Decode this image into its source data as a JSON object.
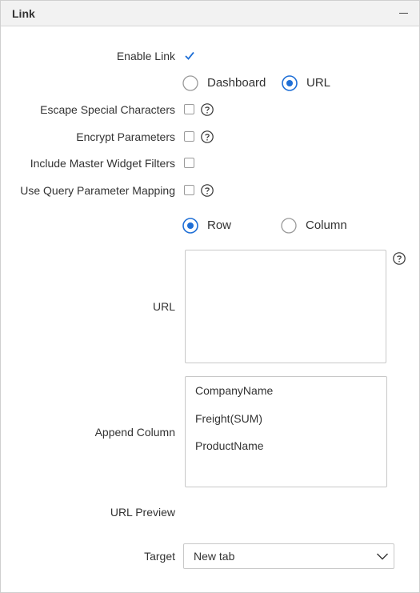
{
  "panel": {
    "title": "Link",
    "collapse_icon": "minus-icon"
  },
  "form": {
    "enable_link": {
      "label": "Enable Link",
      "checked": true
    },
    "link_type": {
      "options": [
        "Dashboard",
        "URL"
      ],
      "selected": "URL"
    },
    "escape_special_characters": {
      "label": "Escape Special Characters",
      "checked": false
    },
    "encrypt_parameters": {
      "label": "Encrypt Parameters",
      "checked": false
    },
    "include_master_widget_filters": {
      "label": "Include Master Widget Filters",
      "checked": false
    },
    "use_query_parameter_mapping": {
      "label": "Use Query Parameter Mapping",
      "checked": false
    },
    "mapping_mode": {
      "options": [
        "Row",
        "Column"
      ],
      "selected": "Row"
    },
    "url": {
      "label": "URL",
      "value": ""
    },
    "append_column": {
      "label": "Append Column",
      "items": [
        "CompanyName",
        "Freight(SUM)",
        "ProductName"
      ]
    },
    "url_preview": {
      "label": "URL Preview",
      "value": ""
    },
    "target": {
      "label": "Target",
      "value": "New tab"
    }
  },
  "colors": {
    "accent": "#1f6fd6",
    "border": "#c8c8c8",
    "header_bg": "#f2f2f2"
  }
}
